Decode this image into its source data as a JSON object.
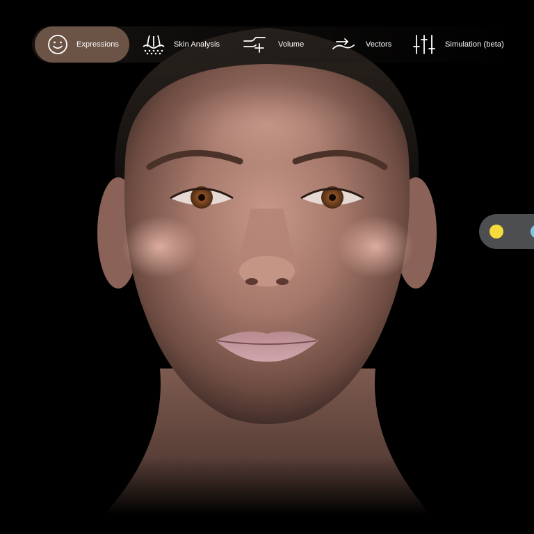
{
  "app": {
    "background_color": "#000000"
  },
  "toolbar": {
    "active_bg_color": "#6b5446",
    "items": [
      {
        "label": "Expressions",
        "icon": "smiley-face-icon",
        "active": true
      },
      {
        "label": "Skin Analysis",
        "icon": "skin-layers-icon",
        "active": false
      },
      {
        "label": "Volume",
        "icon": "volume-wave-plus-icon",
        "active": false
      },
      {
        "label": "Vectors",
        "icon": "vector-wave-arrow-icon",
        "active": false
      },
      {
        "label": "Simulation (beta)",
        "icon": "sliders-icon",
        "active": false
      }
    ]
  },
  "color_switch": {
    "swatches": [
      {
        "name": "yellow",
        "color": "#f5dc3c"
      },
      {
        "name": "blue",
        "color": "#7cc6e8"
      }
    ]
  },
  "viewport": {
    "content": "face-3d-render"
  }
}
